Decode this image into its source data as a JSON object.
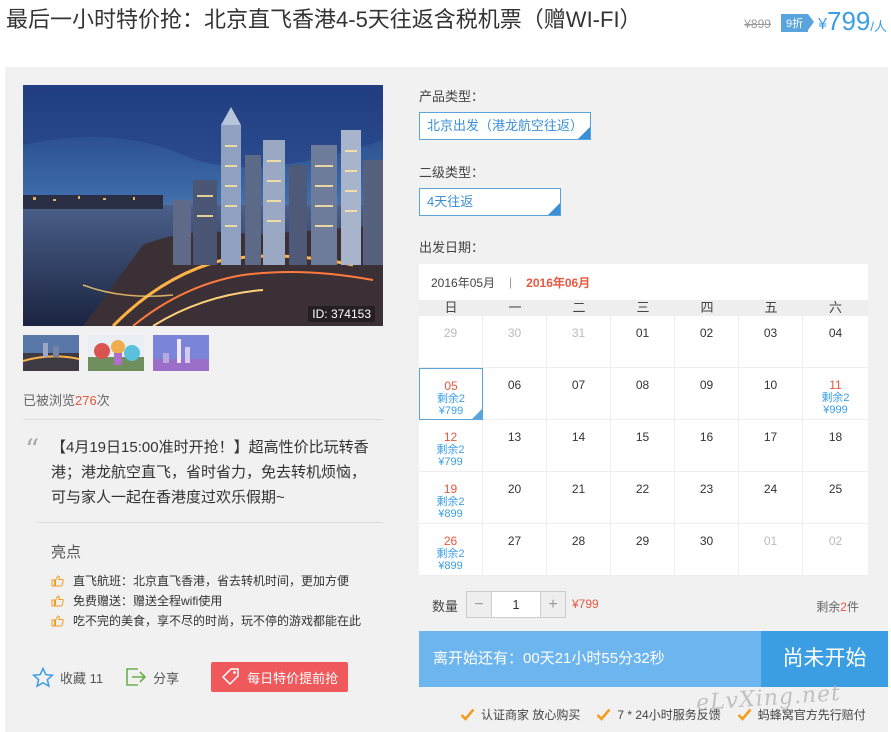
{
  "header": {
    "title": "最后一小时特价抢：北京直飞香港4-5天往返含税机票（赠WI-FI）",
    "old_price": "¥899",
    "discount": "9折",
    "currency": "¥",
    "price": "799",
    "unit": "/人"
  },
  "gallery": {
    "image_id": "ID: 374153",
    "thumbnails": [
      "harbor-thumb",
      "amusement-park-thumb",
      "skyline-thumb"
    ]
  },
  "views": {
    "prefix": "已被浏览",
    "count": "276",
    "suffix": "次"
  },
  "description": "【4月19日15:00准时开抢！】超高性价比玩转香港；港龙航空直飞，省时省力，免去转机烦恼，可与家人一起在香港度过欢乐假期~",
  "highlights": {
    "title": "亮点",
    "items": [
      "直飞航班：北京直飞香港，省去转机时间，更加方便",
      "免费赠送：赠送全程wifi使用",
      "吃不完的美食，享不尽的时尚，玩不停的游戏都能在此"
    ]
  },
  "actions": {
    "favorite": "收藏 11",
    "share": "分享",
    "deal": "每日特价提前抢"
  },
  "options": {
    "product_type_label": "产品类型：",
    "product_type_value": "北京出发（港龙航空往返）",
    "sub_type_label": "二级类型：",
    "sub_type_value": "4天往返",
    "date_label": "出发日期："
  },
  "calendar": {
    "prev_month": "2016年05月",
    "divider": "|",
    "current_month": "2016年06月",
    "weekdays": [
      "日",
      "一",
      "二",
      "三",
      "四",
      "五",
      "六"
    ],
    "rows": [
      [
        {
          "d": "29",
          "off": true
        },
        {
          "d": "30",
          "off": true
        },
        {
          "d": "31",
          "off": true
        },
        {
          "d": "01"
        },
        {
          "d": "02"
        },
        {
          "d": "03"
        },
        {
          "d": "04"
        }
      ],
      [
        {
          "d": "05",
          "s1": "剩余2",
          "s2": "¥799",
          "sel": true
        },
        {
          "d": "06"
        },
        {
          "d": "07"
        },
        {
          "d": "08"
        },
        {
          "d": "09"
        },
        {
          "d": "10"
        },
        {
          "d": "11",
          "s1": "剩余2",
          "s2": "¥999"
        }
      ],
      [
        {
          "d": "12",
          "s1": "剩余2",
          "s2": "¥799"
        },
        {
          "d": "13"
        },
        {
          "d": "14"
        },
        {
          "d": "15"
        },
        {
          "d": "16"
        },
        {
          "d": "17"
        },
        {
          "d": "18"
        }
      ],
      [
        {
          "d": "19",
          "s1": "剩余2",
          "s2": "¥899"
        },
        {
          "d": "20"
        },
        {
          "d": "21"
        },
        {
          "d": "22"
        },
        {
          "d": "23"
        },
        {
          "d": "24"
        },
        {
          "d": "25"
        }
      ],
      [
        {
          "d": "26",
          "s1": "剩余2",
          "s2": "¥899"
        },
        {
          "d": "27"
        },
        {
          "d": "28"
        },
        {
          "d": "29"
        },
        {
          "d": "30"
        },
        {
          "d": "01",
          "off": true
        },
        {
          "d": "02",
          "off": true
        }
      ]
    ]
  },
  "quantity": {
    "label": "数量",
    "minus": "−",
    "plus": "+",
    "value": "1",
    "price": "¥799",
    "remain_prefix": "剩余",
    "remain_count": "2",
    "remain_suffix": "件"
  },
  "timer": {
    "text": "离开始还有：",
    "countdown": "00天21小时55分32秒",
    "button": "尚未开始"
  },
  "guarantees": [
    "认证商家 放心购买",
    "7 * 24小时服务反馈",
    "蚂蜂窝官方先行赔付"
  ],
  "watermark": "eLvXing.net",
  "colors": {
    "accent": "#3b9ee3",
    "red": "#e9573e",
    "deal": "#f0595b",
    "check": "#f39c1e"
  }
}
